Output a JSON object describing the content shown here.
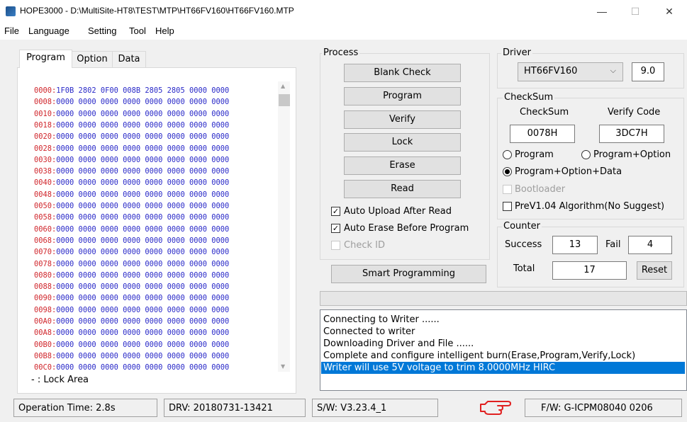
{
  "window": {
    "title": "HOPE3000 - D:\\MultiSite-HT8\\TEST\\MTP\\HT66FV160\\HT66FV160.MTP",
    "minimize": "—",
    "maximize": "☐",
    "close": "✕"
  },
  "menu": [
    "File",
    "Language",
    "Setting",
    "Tool",
    "Help"
  ],
  "tabs": [
    "Program",
    "Option",
    "Data"
  ],
  "hex": [
    {
      "addr": "0000:",
      "vals": "1F0B 2802 0F00 008B 2805 2805 0000 0000"
    },
    {
      "addr": "0008:",
      "vals": "0000 0000 0000 0000 0000 0000 0000 0000"
    },
    {
      "addr": "0010:",
      "vals": "0000 0000 0000 0000 0000 0000 0000 0000"
    },
    {
      "addr": "0018:",
      "vals": "0000 0000 0000 0000 0000 0000 0000 0000"
    },
    {
      "addr": "0020:",
      "vals": "0000 0000 0000 0000 0000 0000 0000 0000"
    },
    {
      "addr": "0028:",
      "vals": "0000 0000 0000 0000 0000 0000 0000 0000"
    },
    {
      "addr": "0030:",
      "vals": "0000 0000 0000 0000 0000 0000 0000 0000"
    },
    {
      "addr": "0038:",
      "vals": "0000 0000 0000 0000 0000 0000 0000 0000"
    },
    {
      "addr": "0040:",
      "vals": "0000 0000 0000 0000 0000 0000 0000 0000"
    },
    {
      "addr": "0048:",
      "vals": "0000 0000 0000 0000 0000 0000 0000 0000"
    },
    {
      "addr": "0050:",
      "vals": "0000 0000 0000 0000 0000 0000 0000 0000"
    },
    {
      "addr": "0058:",
      "vals": "0000 0000 0000 0000 0000 0000 0000 0000"
    },
    {
      "addr": "0060:",
      "vals": "0000 0000 0000 0000 0000 0000 0000 0000"
    },
    {
      "addr": "0068:",
      "vals": "0000 0000 0000 0000 0000 0000 0000 0000"
    },
    {
      "addr": "0070:",
      "vals": "0000 0000 0000 0000 0000 0000 0000 0000"
    },
    {
      "addr": "0078:",
      "vals": "0000 0000 0000 0000 0000 0000 0000 0000"
    },
    {
      "addr": "0080:",
      "vals": "0000 0000 0000 0000 0000 0000 0000 0000"
    },
    {
      "addr": "0088:",
      "vals": "0000 0000 0000 0000 0000 0000 0000 0000"
    },
    {
      "addr": "0090:",
      "vals": "0000 0000 0000 0000 0000 0000 0000 0000"
    },
    {
      "addr": "0098:",
      "vals": "0000 0000 0000 0000 0000 0000 0000 0000"
    },
    {
      "addr": "00A0:",
      "vals": "0000 0000 0000 0000 0000 0000 0000 0000"
    },
    {
      "addr": "00A8:",
      "vals": "0000 0000 0000 0000 0000 0000 0000 0000"
    },
    {
      "addr": "00B0:",
      "vals": "0000 0000 0000 0000 0000 0000 0000 0000"
    },
    {
      "addr": "00B8:",
      "vals": "0000 0000 0000 0000 0000 0000 0000 0000"
    },
    {
      "addr": "00C0:",
      "vals": "0000 0000 0000 0000 0000 0000 0000 0000"
    }
  ],
  "lock_area": "- : Lock Area",
  "process": {
    "label": "Process",
    "buttons": [
      "Blank Check",
      "Program",
      "Verify",
      "Lock",
      "Erase",
      "Read"
    ],
    "auto_upload": "Auto Upload After Read",
    "auto_erase": "Auto Erase Before Program",
    "check_id": "Check ID",
    "smart": "Smart Programming"
  },
  "driver": {
    "label": "Driver",
    "selected": "HT66FV160",
    "version": "9.0"
  },
  "checksum": {
    "label": "CheckSum",
    "col1": "CheckSum",
    "col2": "Verify Code",
    "value1": "0078H",
    "value2": "3DC7H",
    "radio_program": "Program",
    "radio_program_option": "Program+Option",
    "radio_all": "Program+Option+Data",
    "bootloader": "Bootloader",
    "prev": "PreV1.04 Algorithm(No Suggest)"
  },
  "counter": {
    "label": "Counter",
    "success_label": "Success",
    "success": "13",
    "fail_label": "Fail",
    "fail": "4",
    "total_label": "Total",
    "total": "17",
    "reset": "Reset"
  },
  "log": [
    "Connecting to Writer ......",
    "Connected to writer",
    "Downloading Driver and File ......",
    "Complete and configure intelligent burn(Erase,Program,Verify,Lock)",
    "Writer will use 5V voltage to trim 8.0000MHz HIRC"
  ],
  "status": {
    "op_time": "Operation Time: 2.8s",
    "drv": "DRV: 20180731-13421",
    "sw": "S/W: V3.23.4_1",
    "fw": "F/W: G-ICPM08040 0206"
  },
  "colors": {
    "accent": "#0078d7",
    "hex_addr": "#d0262c",
    "hex_vals": "#2929c8",
    "pointer": "#e02020"
  }
}
